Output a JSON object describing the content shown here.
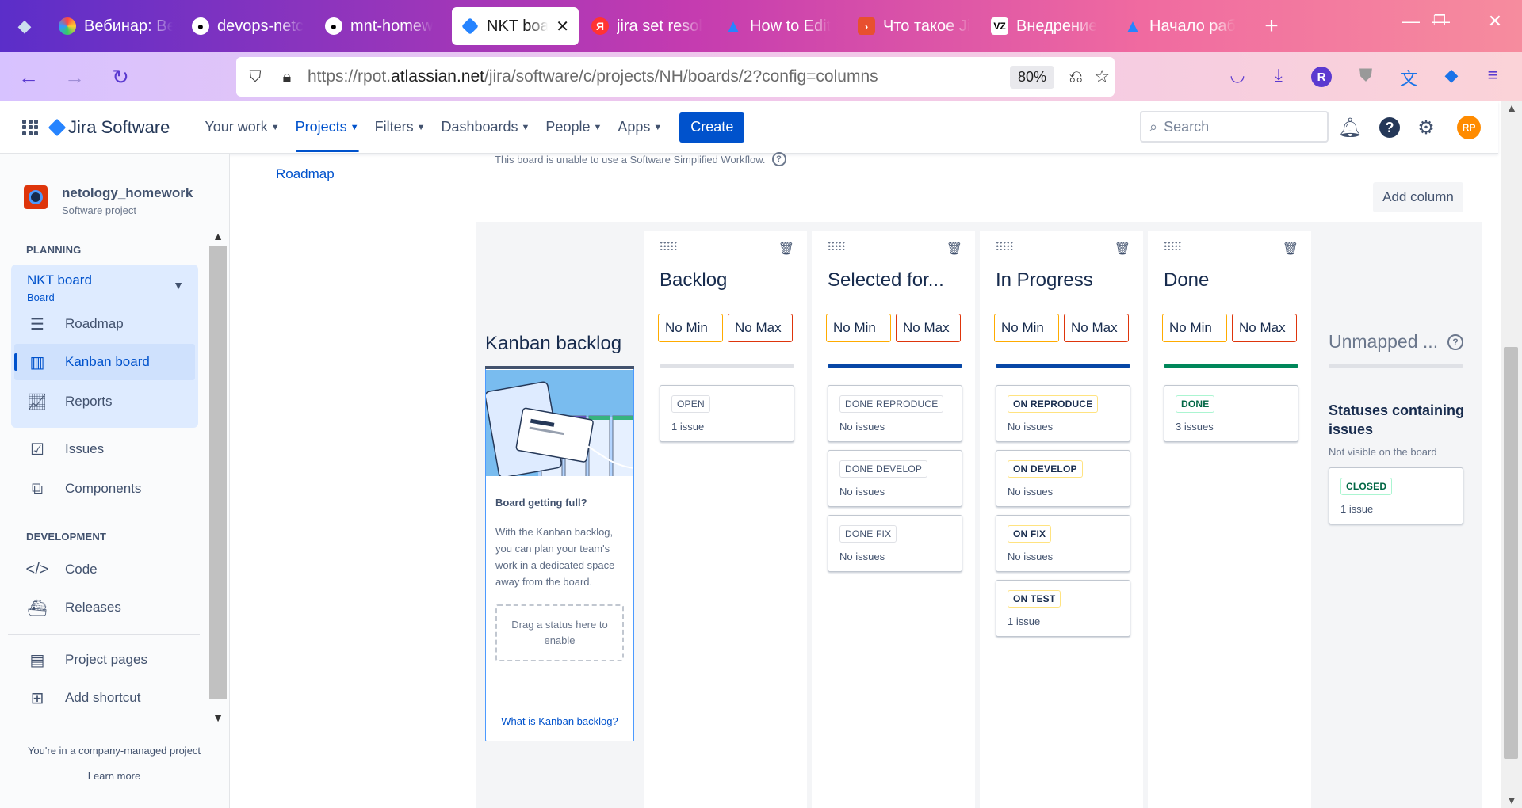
{
  "browser": {
    "tabs": [
      {
        "label": "Вебинар: Ве",
        "icon": "colorful-circle-icon"
      },
      {
        "label": "devops-netc",
        "icon": "github-icon"
      },
      {
        "label": "mnt-homew",
        "icon": "github-icon"
      },
      {
        "label": "NKT board",
        "icon": "jira-icon",
        "active": true
      },
      {
        "label": "jira set resol",
        "icon": "yandex-icon"
      },
      {
        "label": "How to Edit",
        "icon": "atlassian-icon"
      },
      {
        "label": "Что такое Ji",
        "icon": "play-icon"
      },
      {
        "label": "Внедрение",
        "icon": "vz-icon"
      },
      {
        "label": "Начало раб",
        "icon": "atlassian-icon"
      }
    ],
    "url_prefix": "https://rpot.",
    "url_domain": "atlassian.net",
    "url_path": "/jira/software/c/projects/NH/boards/2?config=columns",
    "zoom": "80%",
    "profile_initial": "R"
  },
  "jira": {
    "product": "Jira Software",
    "menu": [
      {
        "label": "Your work"
      },
      {
        "label": "Projects",
        "active": true
      },
      {
        "label": "Filters"
      },
      {
        "label": "Dashboards"
      },
      {
        "label": "People"
      },
      {
        "label": "Apps"
      }
    ],
    "create_label": "Create",
    "search_placeholder": "Search",
    "user_initials": "RP"
  },
  "sidebar": {
    "project_name": "netology_homework",
    "project_type": "Software project",
    "planning_title": "PLANNING",
    "board_name": "NKT board",
    "board_sub": "Board",
    "items": {
      "roadmap": "Roadmap",
      "kanban": "Kanban board",
      "reports": "Reports",
      "issues": "Issues",
      "components": "Components",
      "code": "Code",
      "releases": "Releases",
      "project_pages": "Project pages",
      "add_shortcut": "Add shortcut"
    },
    "development_title": "DEVELOPMENT",
    "footer_text": "You're in a company-managed project",
    "learn_more": "Learn more"
  },
  "main": {
    "roadmap_link": "Roadmap",
    "workflow_note": "This board is unable to use a Software Simplified Workflow.",
    "add_column": "Add column",
    "no_min": "No Min",
    "no_max": "No Max",
    "columns": [
      {
        "title": "Backlog",
        "line_color": "#dfe1e6",
        "statuses": [
          {
            "name": "OPEN",
            "count": "1 issue",
            "style": "grey"
          }
        ]
      },
      {
        "title": "Selected for...",
        "line_color": "#0747a6",
        "statuses": [
          {
            "name": "DONE REPRODUCE",
            "count": "No issues",
            "style": "grey"
          },
          {
            "name": "DONE DEVELOP",
            "count": "No issues",
            "style": "grey"
          },
          {
            "name": "DONE FIX",
            "count": "No issues",
            "style": "grey"
          }
        ]
      },
      {
        "title": "In Progress",
        "line_color": "#0747a6",
        "statuses": [
          {
            "name": "ON REPRODUCE",
            "count": "No issues",
            "style": "yellow"
          },
          {
            "name": "ON DEVELOP",
            "count": "No issues",
            "style": "yellow"
          },
          {
            "name": "ON FIX",
            "count": "No issues",
            "style": "yellow"
          },
          {
            "name": "ON TEST",
            "count": "1 issue",
            "style": "yellow"
          }
        ]
      },
      {
        "title": "Done",
        "line_color": "#00875a",
        "statuses": [
          {
            "name": "DONE",
            "count": "3 issues",
            "style": "green"
          }
        ]
      }
    ],
    "kanban_backlog": {
      "title": "Kanban backlog",
      "heading": "Board getting full?",
      "text": "With the Kanban backlog, you can plan your team's work in a dedicated space away from the board.",
      "drop_text": "Drag a status here to enable",
      "link": "What is Kanban backlog?"
    },
    "unmapped": {
      "title": "Unmapped ...",
      "heading": "Statuses containing issues",
      "sub": "Not visible on the board",
      "status": {
        "name": "CLOSED",
        "count": "1 issue",
        "style": "green"
      }
    }
  }
}
